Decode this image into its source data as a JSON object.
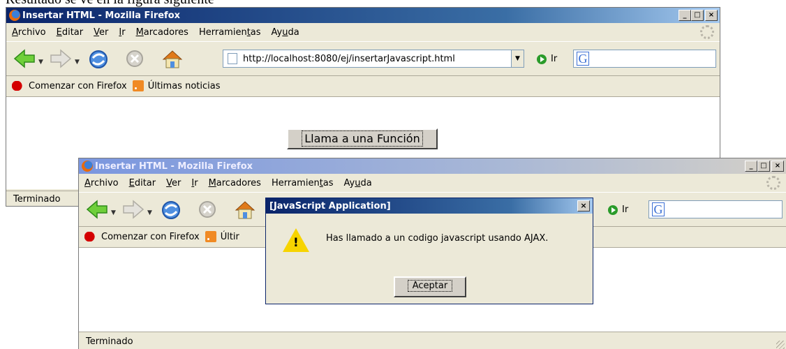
{
  "caption": "Resultado se ve en la figura siguiente",
  "window_title": "Insertar HTML - Mozilla Firefox",
  "menu": [
    {
      "pre": "",
      "ul": "A",
      "post": "rchivo"
    },
    {
      "pre": "",
      "ul": "E",
      "post": "ditar"
    },
    {
      "pre": "",
      "ul": "V",
      "post": "er"
    },
    {
      "pre": "",
      "ul": "I",
      "post": "r"
    },
    {
      "pre": "",
      "ul": "M",
      "post": "arcadores"
    },
    {
      "pre": "Herramien",
      "ul": "t",
      "post": "as"
    },
    {
      "pre": "Ay",
      "ul": "u",
      "post": "da"
    }
  ],
  "url": "http://localhost:8080/ej/insertarJavascript.html",
  "go_label": "Ir",
  "bookmarks": {
    "getting_started": "Comenzar con Firefox",
    "latest_news": "Últimas noticias",
    "latest_news_truncated": "Últir"
  },
  "page_button": "Llama a una Función",
  "status": "Terminado",
  "dialog": {
    "title": "[JavaScript Application]",
    "message": "Has llamado a un codigo javascript usando AJAX.",
    "ok": "Aceptar"
  },
  "colors": {
    "titlebar_active": "#0a246a",
    "chrome": "#ece9d8",
    "warning": "#f7d400"
  },
  "icons": [
    "back-arrow-icon",
    "forward-arrow-icon",
    "reload-icon",
    "stop-icon",
    "home-icon",
    "go-icon",
    "google-icon",
    "firefox-logo-icon",
    "rss-icon",
    "warning-icon"
  ]
}
